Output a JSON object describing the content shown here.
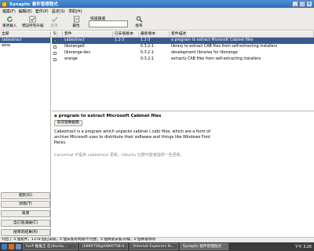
{
  "window": {
    "title": "Synaptic 套件管理程式",
    "controls": [
      "_",
      "□",
      "×"
    ]
  },
  "menu": [
    "檔案(F)",
    "編輯(E)",
    "套件(P)",
    "設定(S)",
    "求助(H)"
  ],
  "toolbar": {
    "reload": "重新載入",
    "mark_all_upgrades": "標記所有升級",
    "apply": "套用",
    "properties": "屬性",
    "quick_filter_label": "快速篩選",
    "search": "搜尋",
    "quick_filter_value": ""
  },
  "filters": {
    "header": "全部",
    "items": [
      "cabextract",
      "wine"
    ],
    "selected_index": 0
  },
  "sidebar_buttons": [
    "組別(G)",
    "狀態(T)",
    "來源",
    "自訂過濾器(C)",
    "搜尋的結果(R)"
  ],
  "table": {
    "columns": [
      "S",
      "",
      "套件",
      "已安裝版本",
      "最新版本",
      "套件描述"
    ],
    "rows": [
      {
        "package": "cabextract",
        "installed": "1.2-3",
        "latest": "1.2-3",
        "description": "a program to extract Microsoft Cabinet files",
        "selected": true
      },
      {
        "package": "liborange0",
        "installed": "",
        "latest": "0.3.2-1",
        "description": "library to extract CAB files from self-extracting installers",
        "selected": false
      },
      {
        "package": "liborange-dev",
        "installed": "",
        "latest": "0.3.2-1",
        "description": "development libraries for liborange",
        "selected": false
      },
      {
        "package": "orange",
        "installed": "",
        "latest": "0.3.2-1",
        "description": "extracts CAB files from self-extracting installers",
        "selected": false
      }
    ]
  },
  "description": {
    "title": "a program to extract Microsoft Cabinet files",
    "screenshot_button": "取得螢幕截圖",
    "body": "Cabextract is a program which unpacks cabinet (.cab) files, which are a form of archive Microsoft uses to distribute their software and things like Windows Font Packs.",
    "note": "Canonical 不提供 cabextract 更新。Ubuntu 社群可能會提供一些更新。"
  },
  "statusbar": "列出了 4 個套件，1378 個已安裝，0 個安裝有問題/不完整，0 個將會安裝/升級，0 個將會移除",
  "taskbar": {
    "tasks": [
      "funP 推推王 在Ubuntu...",
      "[0860758@i0860758-d...",
      "[Internet Explorers fo...",
      "Synaptic 套件管理程式"
    ],
    "active_index": 3,
    "clock": "下午 3:26"
  },
  "icons": {
    "reload": "reload-icon",
    "mark_all": "mark-all-icon",
    "apply": "apply-icon",
    "properties": "properties-icon",
    "search": "search-icon"
  },
  "colors": {
    "titlebar": "#3a7cc8",
    "selection": "#3a5a8f",
    "panel_bg": "#ecebe8",
    "taskbar": "#3b3b3b"
  }
}
